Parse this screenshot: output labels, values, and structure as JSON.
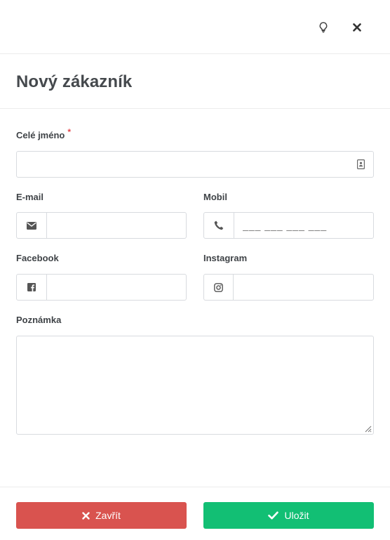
{
  "header": {
    "hint_icon": "lightbulb-icon",
    "close_icon": "close-icon"
  },
  "title": "Nový zákazník",
  "form": {
    "full_name": {
      "label": "Celé jméno",
      "required_mark": "*",
      "value": "",
      "icon": "contact-card-icon"
    },
    "email": {
      "label": "E-mail",
      "value": "",
      "icon": "envelope-icon"
    },
    "mobile": {
      "label": "Mobil",
      "placeholder": "___ ___ ___ ___",
      "value": "",
      "icon": "phone-icon"
    },
    "facebook": {
      "label": "Facebook",
      "value": "",
      "icon": "facebook-icon"
    },
    "instagram": {
      "label": "Instagram",
      "value": "",
      "icon": "instagram-icon"
    },
    "note": {
      "label": "Poznámka",
      "value": ""
    }
  },
  "footer": {
    "cancel_label": "Zavřít",
    "save_label": "Uložit"
  },
  "colors": {
    "danger": "#d9534f",
    "success": "#12bf74",
    "required": "#e5484d"
  }
}
